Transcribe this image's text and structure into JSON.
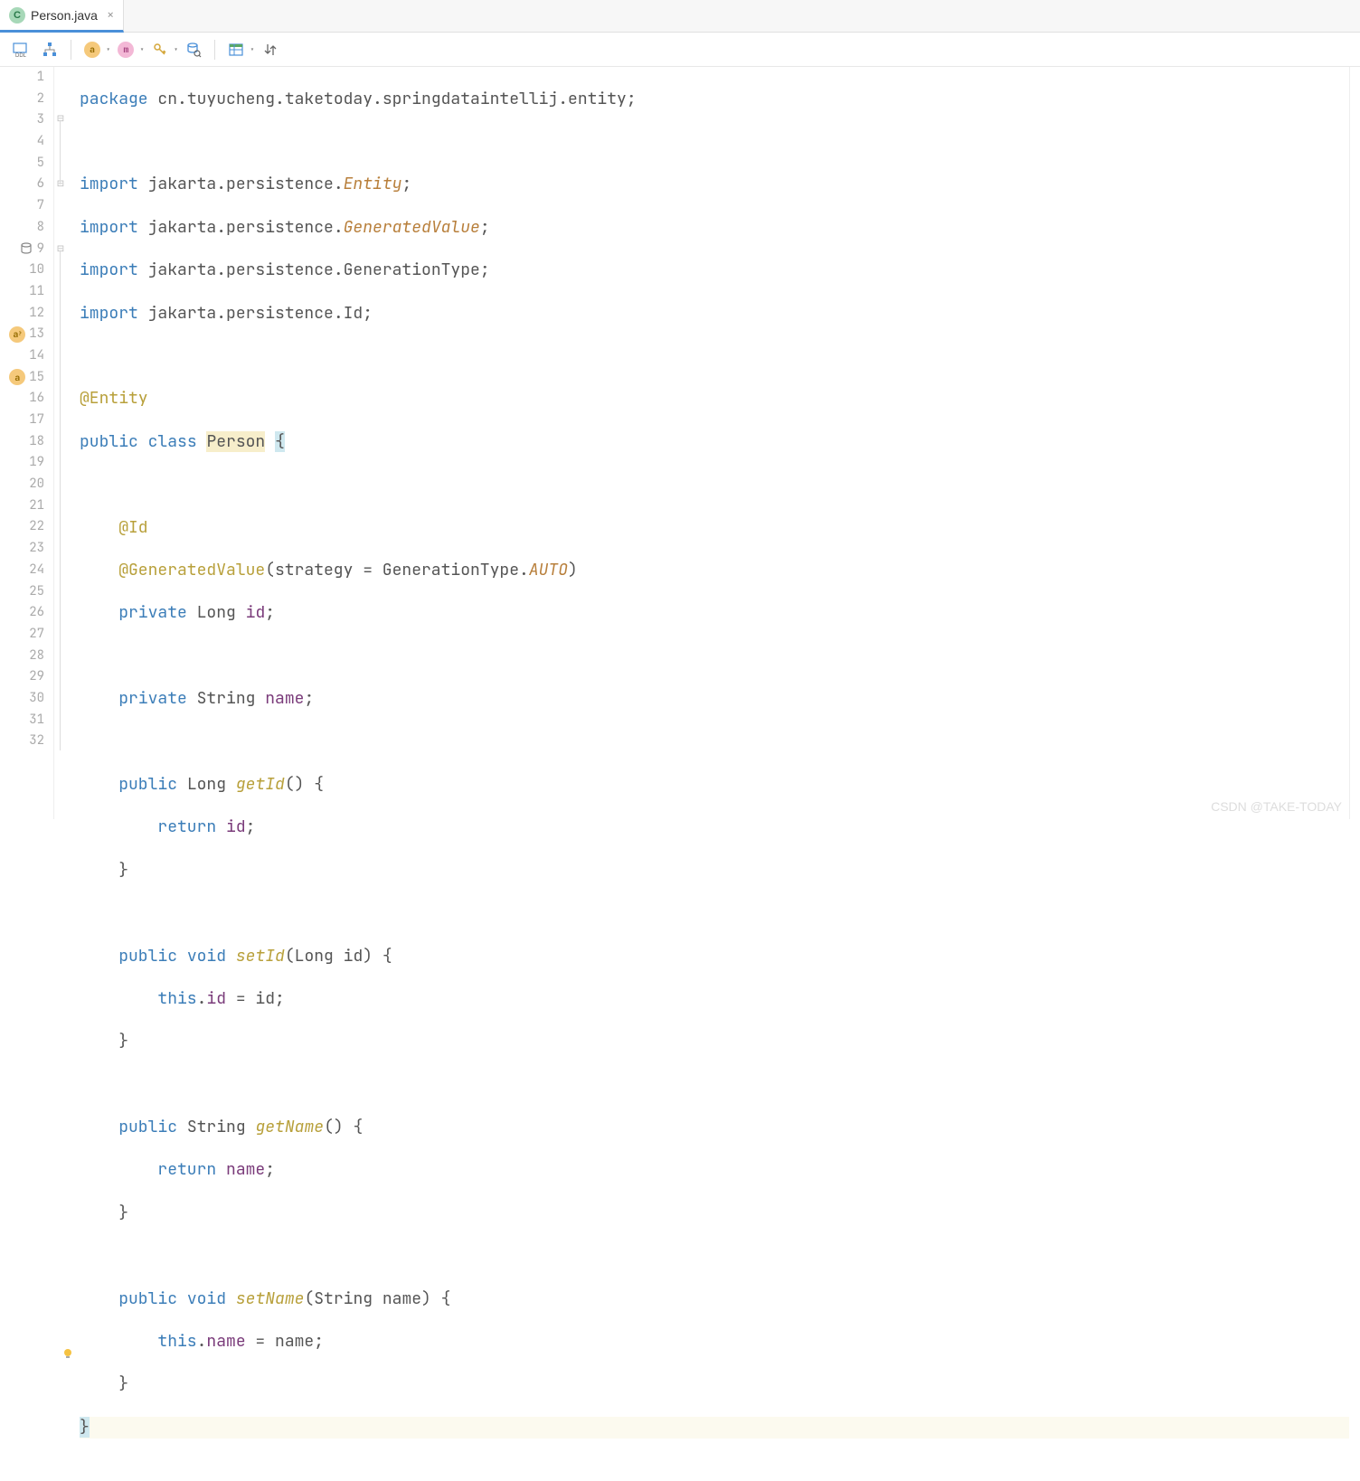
{
  "tab": {
    "filename": "Person.java",
    "icon_letter": "C"
  },
  "watermark": "CSDN @TAKE-TODAY",
  "code": {
    "package": "package",
    "package_path": "cn.tuyucheng.taketoday.springdataintellij.entity",
    "import_kw": "import",
    "imports": [
      "jakarta.persistence.",
      "jakarta.persistence.",
      "jakarta.persistence.GenerationType",
      "jakarta.persistence.Id"
    ],
    "import_suffixes": [
      "Entity",
      "GeneratedValue",
      "GenerationType",
      "Id"
    ],
    "ann_entity": "@Entity",
    "ann_id": "@Id",
    "ann_gen": "@GeneratedValue",
    "gen_params": "(strategy = GenerationType.",
    "gen_auto": "AUTO",
    "public": "public",
    "class": "class",
    "private": "private",
    "void": "void",
    "return": "return",
    "this": "this",
    "class_name": "Person",
    "type_long": "Long",
    "type_string": "String",
    "field_id": "id",
    "field_name": "name",
    "m_getId": "getId",
    "m_setId": "setId",
    "m_getName": "getName",
    "m_setName": "setName"
  },
  "line_numbers": [
    "1",
    "2",
    "3",
    "4",
    "5",
    "6",
    "7",
    "8",
    "9",
    "10",
    "11",
    "12",
    "13",
    "14",
    "15",
    "16",
    "17",
    "18",
    "19",
    "20",
    "21",
    "22",
    "23",
    "24",
    "25",
    "26",
    "27",
    "28",
    "29",
    "30",
    "31",
    "32"
  ]
}
